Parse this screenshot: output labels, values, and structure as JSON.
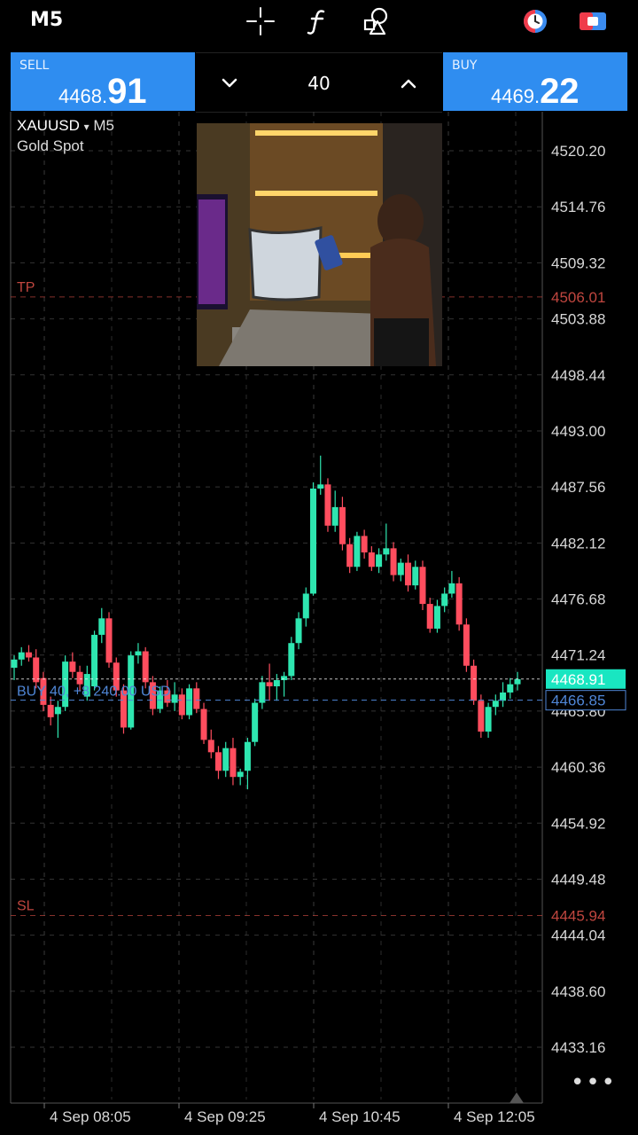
{
  "toolbar": {
    "timeframe": "M5",
    "icons": [
      "crosshair-icon",
      "function-icon",
      "objects-icon",
      "clock-icon",
      "trade-icon"
    ]
  },
  "quote": {
    "sell": {
      "label": "SELL",
      "price_main": "4468.",
      "price_big": "91"
    },
    "buy": {
      "label": "BUY",
      "price_main": "4469.",
      "price_big": "22"
    },
    "volume": "40"
  },
  "symbol": {
    "name": "XAUUSD",
    "arrow": "▾",
    "timeframe": "M5",
    "description": "Gold Spot"
  },
  "chart_data": {
    "type": "candlestick",
    "price_axis": [
      "4520.20",
      "4514.76",
      "4509.32",
      "4503.88",
      "4498.44",
      "4493.00",
      "4487.56",
      "4482.12",
      "4476.68",
      "4471.24",
      "4465.80",
      "4460.36",
      "4454.92",
      "4449.48",
      "4444.04",
      "4438.60",
      "4433.16"
    ],
    "time_axis": [
      "4 Sep 08:05",
      "4 Sep 09:25",
      "4 Sep 10:45",
      "4 Sep 12:05"
    ],
    "ylim": [
      4429.4,
      4522.0
    ],
    "levels": [
      {
        "label": "TP",
        "price": "4506.01",
        "value": 4506.01,
        "color": "#c0463f"
      },
      {
        "label": "SL",
        "price": "4445.94",
        "value": 4445.94,
        "color": "#c0463f"
      }
    ],
    "current_price": {
      "price": "4468.91",
      "value": 4468.91,
      "color": "#19e6c1"
    },
    "position": {
      "label": "BUY 40, +8 240.00 USD",
      "price": "4466.85",
      "value": 4466.85,
      "color": "#4f86d6"
    },
    "up_color": "#2ee6b0",
    "down_color": "#ff4d5e",
    "candles": [
      [
        4470.0,
        4471.2,
        4468.8,
        4470.8
      ],
      [
        4470.8,
        4472.0,
        4470.2,
        4471.5
      ],
      [
        4471.5,
        4472.2,
        4470.6,
        4471.0
      ],
      [
        4471.0,
        4471.8,
        4468.0,
        4468.6
      ],
      [
        4469.0,
        4469.6,
        4465.8,
        4466.4
      ],
      [
        4466.4,
        4467.2,
        4464.4,
        4465.2
      ],
      [
        4465.5,
        4466.8,
        4463.2,
        4466.2
      ],
      [
        4466.2,
        4471.2,
        4465.8,
        4470.6
      ],
      [
        4470.6,
        4471.5,
        4469.0,
        4469.6
      ],
      [
        4469.6,
        4470.2,
        4467.8,
        4468.4
      ],
      [
        4467.2,
        4470.2,
        4466.8,
        4469.4
      ],
      [
        4468.2,
        4473.6,
        4467.8,
        4473.2
      ],
      [
        4473.2,
        4475.8,
        4472.4,
        4474.8
      ],
      [
        4474.8,
        4475.4,
        4470.0,
        4470.5
      ],
      [
        4470.5,
        4471.0,
        4467.2,
        4467.8
      ],
      [
        4467.8,
        4468.4,
        4463.6,
        4464.2
      ],
      [
        4464.2,
        4471.6,
        4464.0,
        4471.2
      ],
      [
        4471.2,
        4472.4,
        4470.4,
        4471.6
      ],
      [
        4471.6,
        4472.0,
        4468.0,
        4468.6
      ],
      [
        4468.6,
        4469.2,
        4465.4,
        4466.0
      ],
      [
        4466.0,
        4468.2,
        4465.6,
        4467.8
      ],
      [
        4467.8,
        4468.8,
        4466.2,
        4466.6
      ],
      [
        4466.6,
        4468.6,
        4465.8,
        4467.4
      ],
      [
        4467.4,
        4468.0,
        4465.0,
        4465.4
      ],
      [
        4465.4,
        4468.4,
        4465.0,
        4468.0
      ],
      [
        4468.0,
        4468.6,
        4465.6,
        4466.0
      ],
      [
        4466.0,
        4466.6,
        4462.6,
        4463.0
      ],
      [
        4463.0,
        4464.0,
        4461.2,
        4461.8
      ],
      [
        4461.8,
        4462.4,
        4459.2,
        4460.0
      ],
      [
        4460.0,
        4462.8,
        4459.4,
        4462.2
      ],
      [
        4462.2,
        4463.2,
        4458.6,
        4459.4
      ],
      [
        4459.4,
        4460.2,
        4458.6,
        4459.9
      ],
      [
        4460.0,
        4463.2,
        4458.2,
        4462.8
      ],
      [
        4462.8,
        4467.0,
        4462.4,
        4466.6
      ],
      [
        4466.6,
        4469.2,
        4466.0,
        4468.6
      ],
      [
        4468.6,
        4470.4,
        4466.8,
        4468.2
      ],
      [
        4468.2,
        4469.4,
        4466.8,
        4468.8
      ],
      [
        4468.8,
        4469.6,
        4467.2,
        4469.2
      ],
      [
        4469.2,
        4473.0,
        4468.8,
        4472.4
      ],
      [
        4472.4,
        4475.4,
        4471.8,
        4474.8
      ],
      [
        4474.8,
        4477.8,
        4474.0,
        4477.2
      ],
      [
        4477.2,
        4488.0,
        4477.0,
        4487.4
      ],
      [
        4487.4,
        4490.6,
        4486.8,
        4487.8
      ],
      [
        4487.8,
        4488.4,
        4483.2,
        4483.8
      ],
      [
        4483.8,
        4487.2,
        4483.2,
        4485.6
      ],
      [
        4485.6,
        4486.6,
        4481.4,
        4482.0
      ],
      [
        4482.0,
        4482.6,
        4479.2,
        4479.8
      ],
      [
        4479.8,
        4483.2,
        4479.4,
        4482.8
      ],
      [
        4482.8,
        4483.4,
        4480.6,
        4481.2
      ],
      [
        4481.2,
        4481.8,
        4479.4,
        4479.8
      ],
      [
        4479.8,
        4481.6,
        4479.2,
        4481.0
      ],
      [
        4481.0,
        4484.0,
        4480.4,
        4481.6
      ],
      [
        4481.6,
        4482.2,
        4478.4,
        4479.0
      ],
      [
        4479.0,
        4480.6,
        4478.4,
        4480.2
      ],
      [
        4480.2,
        4481.0,
        4477.4,
        4478.0
      ],
      [
        4478.0,
        4480.4,
        4477.6,
        4479.8
      ],
      [
        4479.8,
        4480.4,
        4475.6,
        4476.2
      ],
      [
        4476.2,
        4476.8,
        4473.4,
        4473.8
      ],
      [
        4473.8,
        4476.6,
        4473.4,
        4476.0
      ],
      [
        4476.0,
        4477.8,
        4475.4,
        4477.2
      ],
      [
        4477.2,
        4479.4,
        4476.8,
        4478.2
      ],
      [
        4478.2,
        4478.8,
        4473.6,
        4474.2
      ],
      [
        4474.2,
        4474.8,
        4469.6,
        4470.2
      ],
      [
        4470.2,
        4470.8,
        4466.4,
        4466.8
      ],
      [
        4466.8,
        4467.4,
        4463.2,
        4463.8
      ],
      [
        4463.8,
        4466.6,
        4463.2,
        4466.2
      ],
      [
        4466.2,
        4467.4,
        4465.4,
        4466.8
      ],
      [
        4466.8,
        4468.6,
        4466.2,
        4467.6
      ],
      [
        4467.6,
        4469.0,
        4467.0,
        4468.4
      ],
      [
        4468.4,
        4469.6,
        4467.8,
        4468.9
      ]
    ]
  }
}
